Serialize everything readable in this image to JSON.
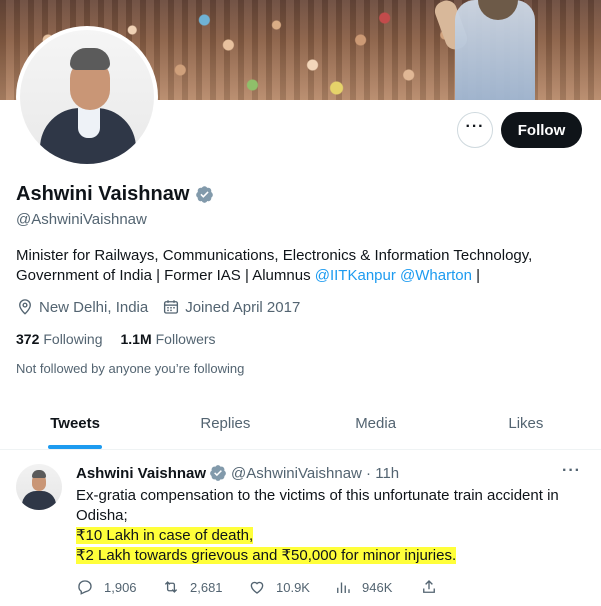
{
  "profile": {
    "name": "Ashwini Vaishnaw",
    "handle": "@AshwiniVaishnaw",
    "bio_text": "Minister for Railways, Communications, Electronics & Information Technology, Government of India | Former IAS | Alumnus ",
    "bio_link1": "@IITKanpur",
    "bio_link2": "@Wharton",
    "bio_end": " |",
    "location": "New Delhi, India",
    "joined": "Joined April 2017",
    "following_count": "372",
    "following_label": "Following",
    "followers_count": "1.1M",
    "followers_label": "Followers",
    "not_followed": "Not followed by anyone you’re following",
    "follow_label": "Follow",
    "more_label": "···"
  },
  "tabs": [
    {
      "label": "Tweets",
      "active": true
    },
    {
      "label": "Replies",
      "active": false
    },
    {
      "label": "Media",
      "active": false
    },
    {
      "label": "Likes",
      "active": false
    }
  ],
  "tweet": {
    "name": "Ashwini Vaishnaw",
    "handle_time": "@AshwiniVaishnaw · 11h",
    "more_label": "···",
    "lines": [
      "Ex-gratia compensation to the victims of this unfortunate train accident in Odisha;"
    ],
    "highlight_lines": [
      "₹10 Lakh in case of death,",
      "₹2 Lakh towards grievous and ₹50,000 for minor injuries."
    ],
    "replies": "1,906",
    "retweets": "2,681",
    "likes": "10.9K",
    "views": "946K"
  },
  "colors": {
    "accent": "#1d9bf0",
    "highlight": "#ffff3a",
    "verified": "#829aab",
    "text": "#0f1419",
    "muted": "#536471"
  },
  "icons": [
    "verified-badge-icon",
    "location-pin-icon",
    "calendar-icon",
    "reply-icon",
    "retweet-icon",
    "like-icon",
    "views-icon",
    "share-icon",
    "more-icon"
  ]
}
